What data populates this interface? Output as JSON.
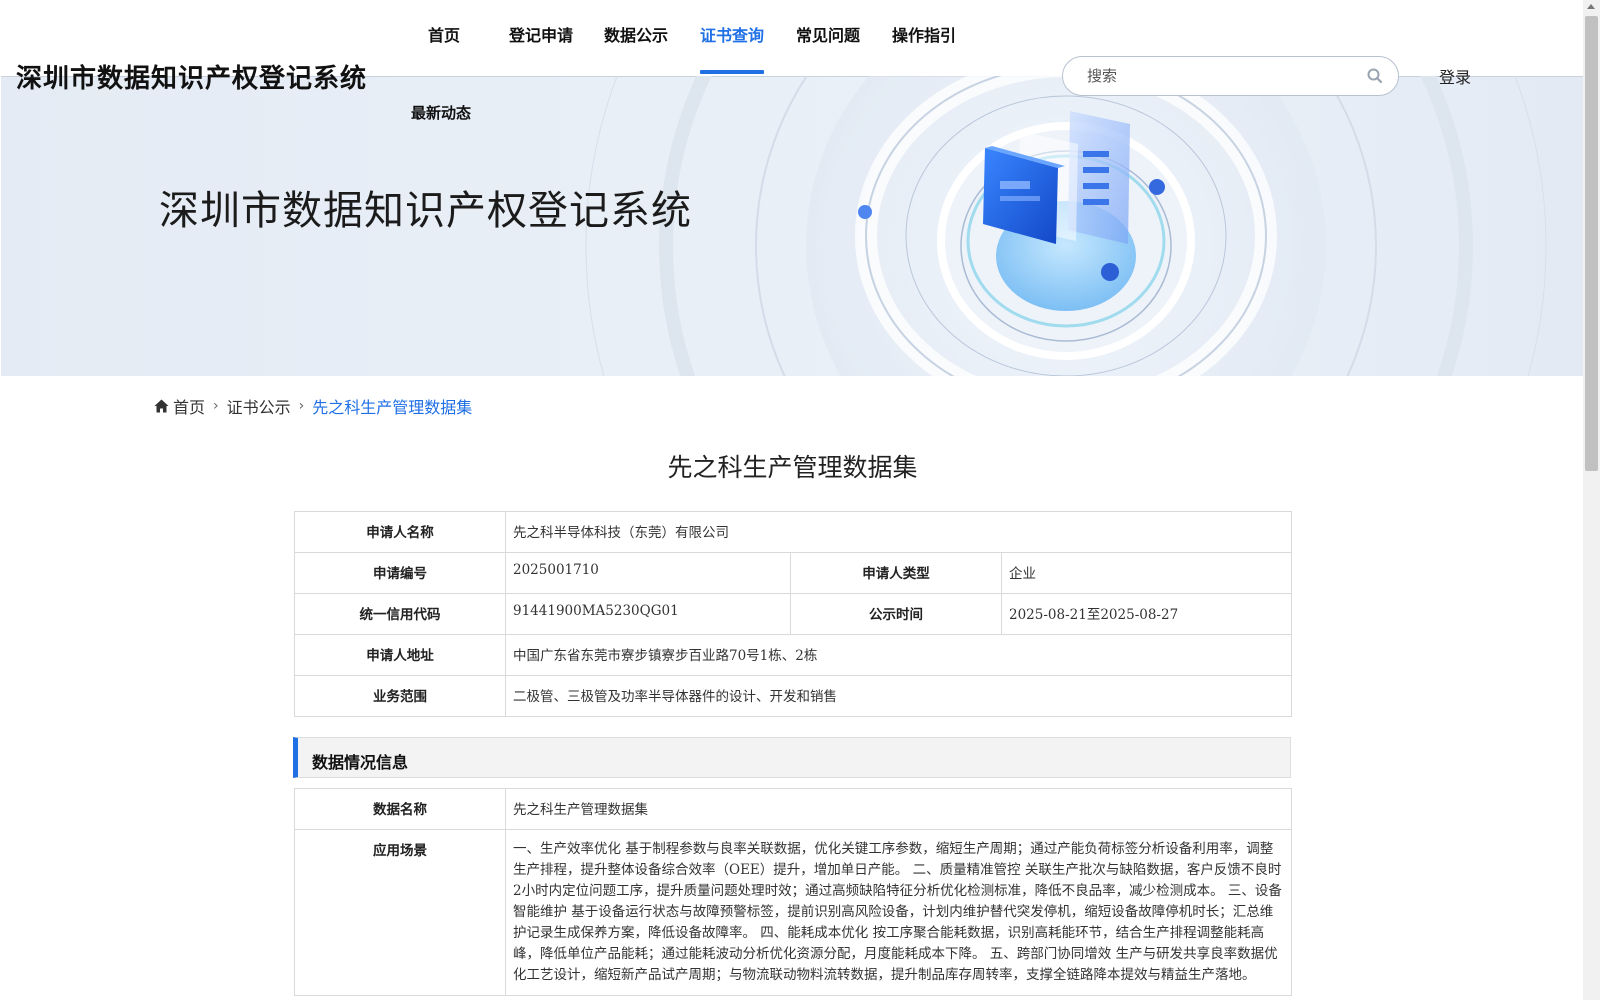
{
  "site": {
    "title": "深圳市数据知识产权登记系统"
  },
  "nav": {
    "items": [
      {
        "label": "首页"
      },
      {
        "label": "登记申请"
      },
      {
        "label": "数据公示"
      },
      {
        "label": "证书查询",
        "active": true
      },
      {
        "label": "常见问题"
      },
      {
        "label": "操作指引"
      },
      {
        "label": "最新动态"
      }
    ]
  },
  "search": {
    "placeholder": "搜索",
    "icon": "search-icon"
  },
  "login": {
    "label": "登录"
  },
  "banner": {
    "title": "深圳市数据知识产权登记系统"
  },
  "breadcrumb": {
    "home": "首页",
    "section": "证书公示",
    "current": "先之科生产管理数据集"
  },
  "page": {
    "title": "先之科生产管理数据集"
  },
  "applicant": {
    "name_label": "申请人名称",
    "name": "先之科半导体科技（东莞）有限公司",
    "number_label": "申请编号",
    "number": "2025001710",
    "type_label": "申请人类型",
    "type": "企业",
    "credit_label": "统一信用代码",
    "credit": "91441900MA5230QG01",
    "publicity_label": "公示时间",
    "publicity": "2025-08-21至2025-08-27",
    "address_label": "申请人地址",
    "address": "中国广东省东莞市寮步镇寮步百业路70号1栋、2栋",
    "scope_label": "业务范围",
    "scope": "二极管、三极管及功率半导体器件的设计、开发和销售"
  },
  "data_info": {
    "section_title": "数据情况信息",
    "name_label": "数据名称",
    "name": "先之科生产管理数据集",
    "scenario_label": "应用场景",
    "scenario": "一、生产效率优化 基于制程参数与良率关联数据，优化关键工序参数，缩短生产周期；通过产能负荷标签分析设备利用率，调整生产排程，提升整体设备综合效率（OEE）提升，增加单日产能。 二、质量精准管控 关联生产批次与缺陷数据，客户反馈不良时2小时内定位问题工序，提升质量问题处理时效；通过高频缺陷特征分析优化检测标准，降低不良品率，减少检测成本。 三、设备智能维护 基于设备运行状态与故障预警标签，提前识别高风险设备，计划内维护替代突发停机，缩短设备故障停机时长；汇总维护记录生成保养方案，降低设备故障率。 四、能耗成本优化 按工序聚合能耗数据，识别高耗能环节，结合生产排程调整能耗高峰，降低单位产品能耗；通过能耗波动分析优化资源分配，月度能耗成本下降。 五、跨部门协同增效 生产与研发共享良率数据优化工艺设计，缩短新产品试产周期；与物流联动物料流转数据，提升制品库存周转率，支撑全链路降本提效与精益生产落地。"
  },
  "colors": {
    "accent": "#1f6fe5",
    "banner": "#e6edf6",
    "border": "#d9d9d9"
  }
}
